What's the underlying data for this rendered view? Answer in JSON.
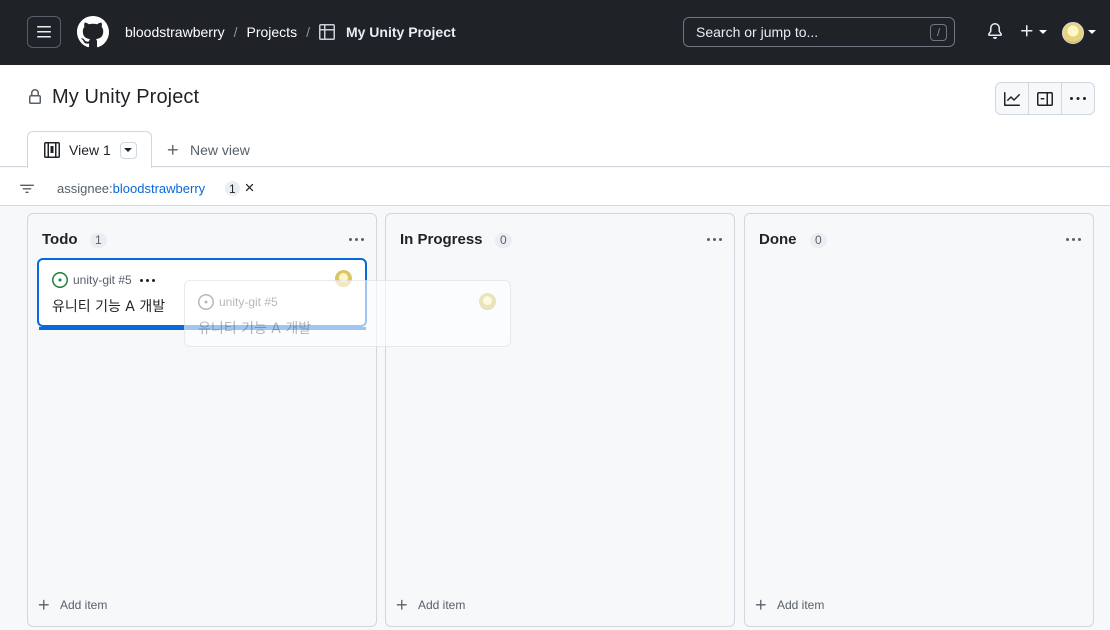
{
  "header": {
    "breadcrumb": {
      "owner": "bloodstrawberry",
      "section": "Projects",
      "project": "My Unity Project"
    },
    "search": {
      "placeholder": "Search or jump to...",
      "shortcut": "/"
    }
  },
  "project": {
    "title": "My Unity Project",
    "tabs": [
      {
        "label": "View 1",
        "active": true
      }
    ],
    "new_view_label": "New view"
  },
  "filter": {
    "key": "assignee:",
    "value": "bloodstrawberry",
    "count": "1"
  },
  "columns": [
    {
      "title": "Todo",
      "count": "1",
      "add_item_label": "Add item",
      "cards": [
        {
          "ref": "unity-git #5",
          "title": "유니티 기능 A 개발",
          "status_color": "#1a7f37"
        }
      ]
    },
    {
      "title": "In Progress",
      "count": "0",
      "add_item_label": "Add item",
      "cards": []
    },
    {
      "title": "Done",
      "count": "0",
      "add_item_label": "Add item",
      "cards": []
    }
  ],
  "drag_ghost": {
    "ref": "unity-git #5",
    "title": "유니티 기능 A 개발"
  },
  "colors": {
    "accent": "#0969da",
    "header_bg": "#1f2328",
    "open_issue": "#1a7f37"
  }
}
